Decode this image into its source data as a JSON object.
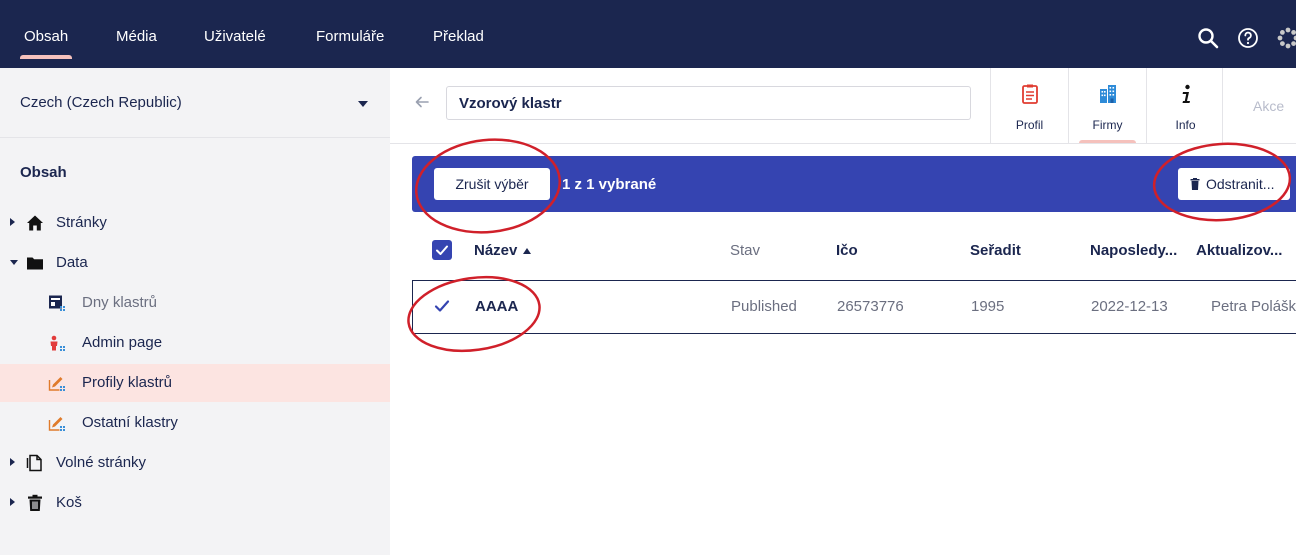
{
  "topnav": {
    "items": [
      {
        "label": "Obsah",
        "active": true
      },
      {
        "label": "Média"
      },
      {
        "label": "Uživatelé"
      },
      {
        "label": "Formuláře"
      },
      {
        "label": "Překlad"
      }
    ],
    "icons": [
      "search-icon",
      "help-icon",
      "settings-icon"
    ]
  },
  "sidebar": {
    "language": "Czech (Czech Republic)",
    "section_title": "Obsah",
    "items": [
      {
        "label": "Stránky",
        "icon": "home-icon",
        "expand": "collapsed"
      },
      {
        "label": "Data",
        "icon": "folder-icon",
        "expand": "expanded"
      },
      {
        "label": "Dny klastrů",
        "icon": "calendar-grid-icon",
        "muted": true
      },
      {
        "label": "Admin page",
        "icon": "people-icon"
      },
      {
        "label": "Profily klastrů",
        "icon": "edit-grid-icon",
        "active": true
      },
      {
        "label": "Ostatní klastry",
        "icon": "edit-grid-icon"
      },
      {
        "label": "Volné stránky",
        "icon": "document-icon",
        "expand": "collapsed"
      },
      {
        "label": "Koš",
        "icon": "trash-icon",
        "expand": "collapsed"
      }
    ]
  },
  "header": {
    "name_value": "Vzorový klastr",
    "tabs": [
      {
        "label": "Profil",
        "icon": "clipboard-icon"
      },
      {
        "label": "Firmy",
        "icon": "building-icon",
        "active": true
      },
      {
        "label": "Info",
        "icon": "info-icon"
      }
    ],
    "actions_label": "Akce"
  },
  "selection": {
    "clear_label": "Zrušit výběr",
    "count_label": "1 z 1 vybrané",
    "delete_label": "Odstranit..."
  },
  "table": {
    "columns": [
      "Název",
      "Stav",
      "Ičo",
      "Seřadit",
      "Naposledy...",
      "Aktualizov..."
    ],
    "rows": [
      {
        "name": "AAAA",
        "status": "Published",
        "ico": "26573776",
        "sort": "1995",
        "last": "2022-12-13",
        "updated_by": "Petra Polášková"
      }
    ]
  },
  "colors": {
    "nav_bg": "#1b264f",
    "accent": "#3544b1",
    "active_item_bg": "#fce4e1",
    "annotation": "#d0202a"
  }
}
